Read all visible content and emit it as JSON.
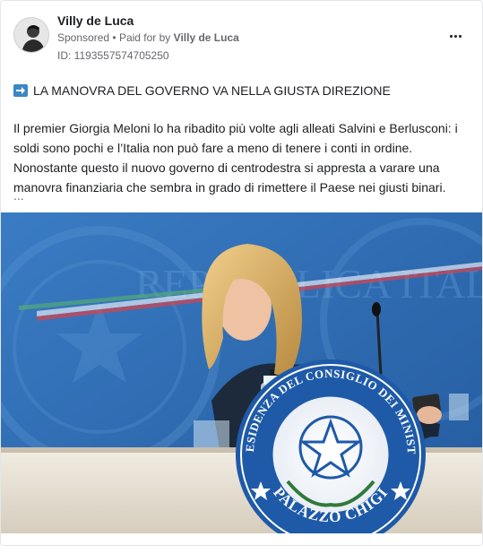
{
  "post": {
    "page_name": "Villy de Luca",
    "sponsored_label": "Sponsored",
    "separator": "•",
    "paid_for_prefix": "Paid for by",
    "paid_for_name": "Villy de Luca",
    "ad_id": "ID: 1193557574705250",
    "more_icon": "more-horizontal-icon",
    "headline_icon": "arrow-right-emoji",
    "headline": "LA MANOVRA DEL GOVERNO VA NELLA GIUSTA DIREZIONE",
    "body_lines": [
      "Il premier Giorgia Meloni lo ha ribadito più volte agli alleati Salvini e Berlusconi: i",
      "soldi sono pochi e l’Italia non può fare a meno di tenere i conti in ordine.",
      "Nonostante questo il nuovo governo di centrodestra si appresta a varare una",
      "manovra finanziaria che sembra in grado di rimettere il Paese nei giusti binari."
    ],
    "see_more": "..."
  },
  "image": {
    "seal_top_text": "PRESIDENZA DEL CONSIGLIO DEI MINISTRI",
    "seal_bottom_text": "PALAZZO CHIGI",
    "wall_text": "REPUBBLICA ITALIANA",
    "colors": {
      "wall_blue": "#2f69b3",
      "podium": "#e9e2d6",
      "seal_blue": "#1e5aa8"
    }
  }
}
